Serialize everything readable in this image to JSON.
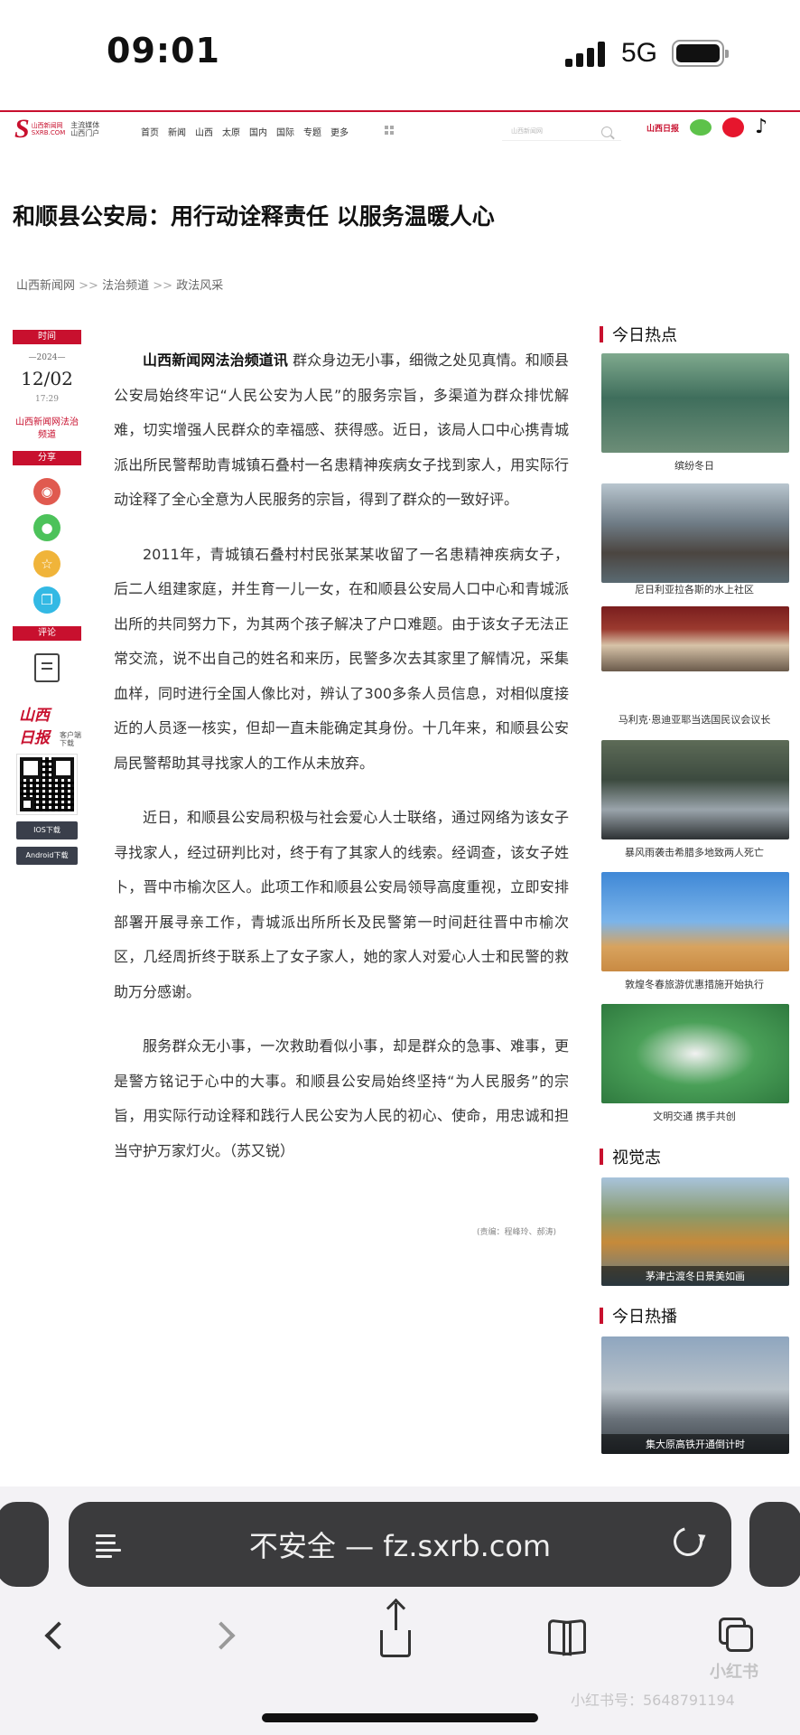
{
  "status_bar": {
    "time": "09:01",
    "network": "5G"
  },
  "site": {
    "logo_mark": "S",
    "logo_text": "山西新闻网\nSXRB.COM",
    "slogan": "主流媒体\n山西门户",
    "nav": [
      "首页",
      "新闻",
      "山西",
      "太原",
      "国内",
      "国际",
      "专题",
      "更多"
    ],
    "search_placeholder": "山西新闻网",
    "brand_badge": "山西日报"
  },
  "article": {
    "title": "和顺县公安局：用行动诠释责任 以服务温暖人心",
    "breadcrumb": [
      "山西新闻网",
      "法治频道",
      "政法风采"
    ],
    "breadcrumb_sep": ">>",
    "meta": {
      "time_label": "时间",
      "year": "—2024—",
      "month_day": "12/02",
      "clock": "17:29",
      "source": "山西新闻网法治频道",
      "share_label": "分享",
      "comment_label": "评论"
    },
    "lead": "山西新闻网法治频道讯",
    "paragraphs": [
      " 群众身边无小事，细微之处见真情。和顺县公安局始终牢记“人民公安为人民”的服务宗旨，多渠道为群众排忧解难，切实增强人民群众的幸福感、获得感。近日，该局人口中心携青城派出所民警帮助青城镇石叠村一名患精神疾病女子找到家人，用实际行动诠释了全心全意为人民服务的宗旨，得到了群众的一致好评。",
      "2011年，青城镇石叠村村民张某某收留了一名患精神疾病女子，后二人组建家庭，并生育一儿一女，在和顺县公安局人口中心和青城派出所的共同努力下，为其两个孩子解决了户口难题。由于该女子无法正常交流，说不出自己的姓名和来历，民警多次去其家里了解情况，采集血样，同时进行全国人像比对，辨认了300多条人员信息，对相似度接近的人员逐一核实，但却一直未能确定其身份。十几年来，和顺县公安局民警帮助其寻找家人的工作从未放弃。",
      "近日，和顺县公安局积极与社会爱心人士联络，通过网络为该女子寻找家人，经过研判比对，终于有了其家人的线索。经调查，该女子姓卜，晋中市榆次区人。此项工作和顺县公安局领导高度重视，立即安排部署开展寻亲工作，青城派出所所长及民警第一时间赶往晋中市榆次区，几经周折终于联系上了女子家人，她的家人对爱心人士和民警的救助万分感谢。",
      "服务群众无小事，一次救助看似小事，却是群众的急事、难事，更是警方铭记于心中的大事。和顺县公安局始终坚持“为人民服务”的宗旨，用实际行动诠释和践行人民公安为人民的初心、使命，用忠诚和担当守护万家灯火。（苏又锐）"
    ],
    "editor": "(责编：程峰玲、郝涛)"
  },
  "app_promo": {
    "brand": "山西日报",
    "caption": "客户端\n下载",
    "ios_label": "IOS下载",
    "android_label": "Android下载"
  },
  "sidebar": {
    "hot_title": "今日热点",
    "hot_items": [
      {
        "caption": "缤纷冬日"
      },
      {
        "caption": "尼日利亚拉各斯的水上社区"
      },
      {
        "caption": "马利克·恩迪亚耶当选国民议会议长"
      },
      {
        "caption": "暴风雨袭击希腊多地致两人死亡"
      },
      {
        "caption": "敦煌冬春旅游优惠措施开始执行"
      },
      {
        "caption": "文明交通 携手共创"
      }
    ],
    "vision_title": "视觉志",
    "vision_item": {
      "caption": "茅津古渡冬日景美如画"
    },
    "broadcast_title": "今日热播",
    "broadcast_item": {
      "caption": "集大原高铁开通倒计时"
    }
  },
  "browser": {
    "url_display": "不安全 — fz.sxrb.com"
  },
  "watermark": {
    "text": "小红书号：5648791194",
    "logo": "小红书"
  },
  "colors": {
    "brand_red": "#c8102e",
    "browser_bar": "#3b3b3d"
  }
}
